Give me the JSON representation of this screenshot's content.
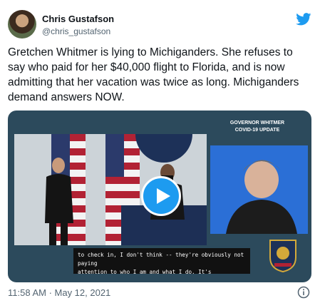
{
  "author": {
    "name": "Chris Gustafson",
    "handle": "@chris_gustafson"
  },
  "tweet": {
    "text": "Gretchen Whitmer is lying to Michiganders. She refuses to say who paid for her $40,000 flight to Florida, and is now admitting that her vacation was twice as long. Michiganders demand answers NOW.",
    "timestamp": "11:58 AM · May 12, 2021"
  },
  "video": {
    "overlay_line1": "GOVERNOR WHITMER",
    "overlay_line2": "COVID-19 UPDATE",
    "caption_line1": "to check in, I don't think -- they're obviously not paying",
    "caption_line2": "attention to who I am and what I do.  It's"
  },
  "icons": [
    "twitter-bird-icon",
    "play-icon",
    "info-icon"
  ],
  "colors": {
    "accent": "#1d9bf0",
    "secondary_text": "#536471"
  }
}
